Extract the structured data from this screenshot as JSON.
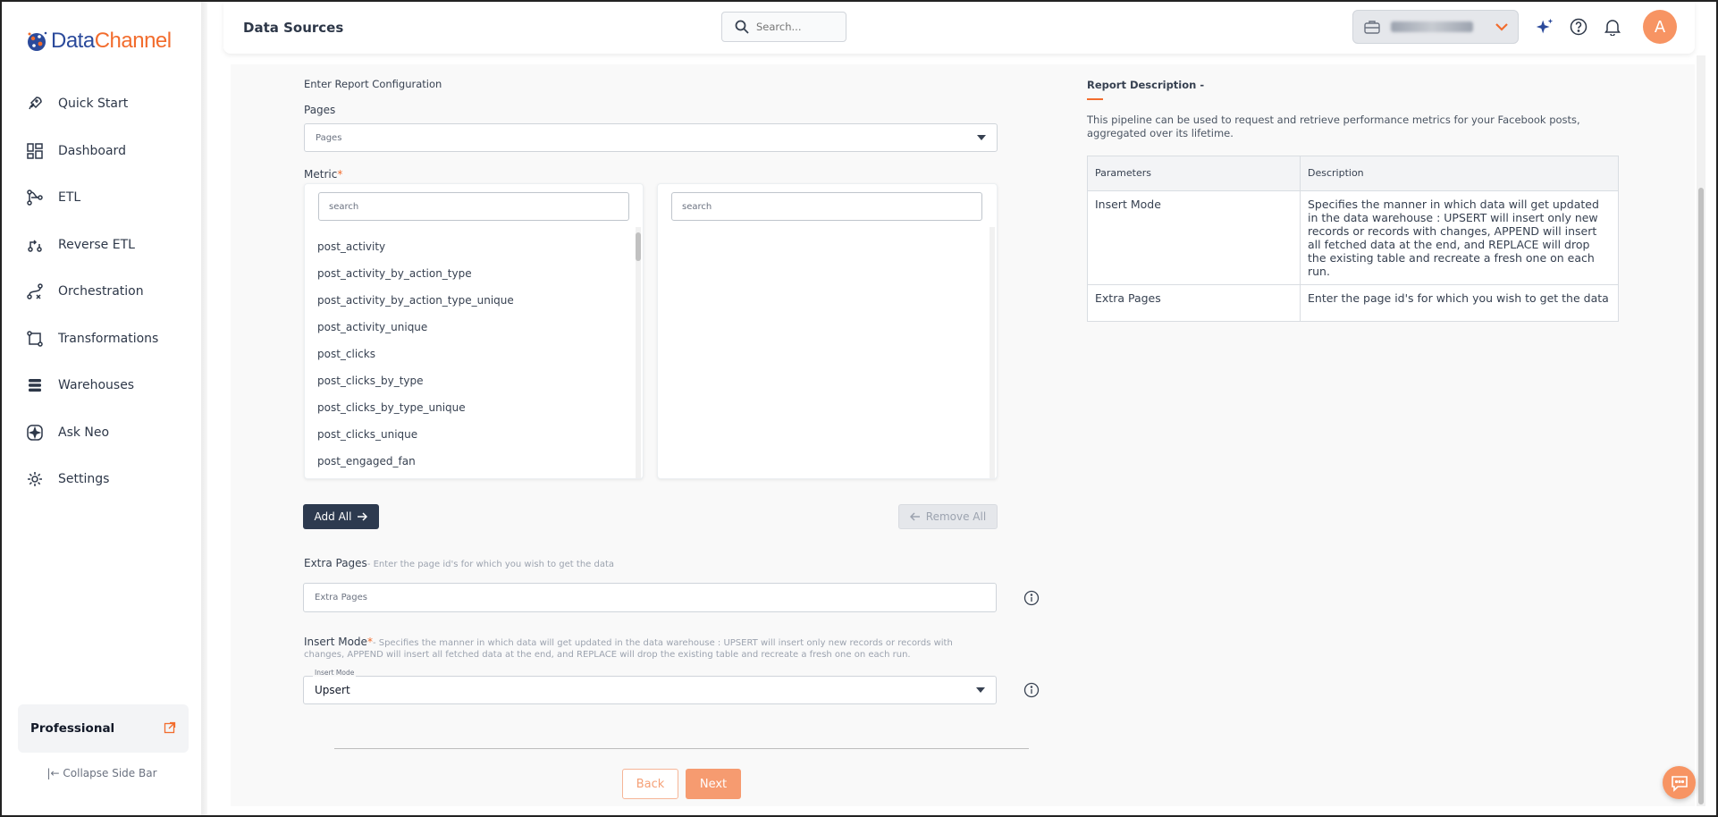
{
  "brand": {
    "name_part1": "Data",
    "name_part2": "Channel",
    "accent": "#f26c2d",
    "primary": "#2b4a9b"
  },
  "sidebar": {
    "items": [
      {
        "label": "Quick Start",
        "icon": "rocket-icon"
      },
      {
        "label": "Dashboard",
        "icon": "dashboard-icon"
      },
      {
        "label": "ETL",
        "icon": "etl-icon"
      },
      {
        "label": "Reverse ETL",
        "icon": "reverse-etl-icon"
      },
      {
        "label": "Orchestration",
        "icon": "orchestration-icon"
      },
      {
        "label": "Transformations",
        "icon": "transformations-icon"
      },
      {
        "label": "Warehouses",
        "icon": "warehouses-icon"
      },
      {
        "label": "Ask Neo",
        "icon": "sparkle-icon"
      },
      {
        "label": "Settings",
        "icon": "gear-icon"
      }
    ],
    "plan": "Professional",
    "collapse_label": "Collapse Side Bar"
  },
  "header": {
    "title": "Data Sources",
    "search_placeholder": "Search...",
    "avatar_initial": "A"
  },
  "form": {
    "section_title": "Enter Report Configuration",
    "pages_label": "Pages",
    "pages_placeholder": "Pages",
    "metric_label": "Metric",
    "required_mark": "*",
    "available_search_placeholder": "search",
    "selected_search_placeholder": "search",
    "available_metrics": [
      "post_activity",
      "post_activity_by_action_type",
      "post_activity_by_action_type_unique",
      "post_activity_unique",
      "post_clicks",
      "post_clicks_by_type",
      "post_clicks_by_type_unique",
      "post_clicks_unique",
      "post_engaged_fan"
    ],
    "add_all_label": "Add All",
    "remove_all_label": "Remove All",
    "extra_pages_label": "Extra Pages",
    "extra_pages_help": "- Enter the page id's for which you wish to get the data",
    "extra_pages_placeholder": "Extra Pages",
    "insert_mode_label": "Insert Mode",
    "insert_mode_help_line1": "- Specifies the manner in which data will get updated in the data warehouse : UPSERT will insert only new records or records with",
    "insert_mode_help_line2": "changes, APPEND will insert all fetched data at the end, and REPLACE will drop the existing table and recreate a fresh one on each run.",
    "insert_mode_float_label": "Insert Mode",
    "insert_mode_value": "Upsert",
    "back_label": "Back",
    "next_label": "Next"
  },
  "description": {
    "title": "Report Description -",
    "text": "This pipeline can be used to request and retrieve performance metrics for your Facebook posts, aggregated over its lifetime.",
    "table_headers": [
      "Parameters",
      "Description"
    ],
    "rows": [
      {
        "param": "Insert Mode",
        "desc": "Specifies the manner in which data will get updated in the data warehouse : UPSERT will insert only new records or records with changes, APPEND will insert all fetched data at the end, and REPLACE will drop the existing table and recreate a fresh one on each run."
      },
      {
        "param": "Extra Pages",
        "desc": "Enter the page id's for which you wish to get the data"
      }
    ]
  }
}
